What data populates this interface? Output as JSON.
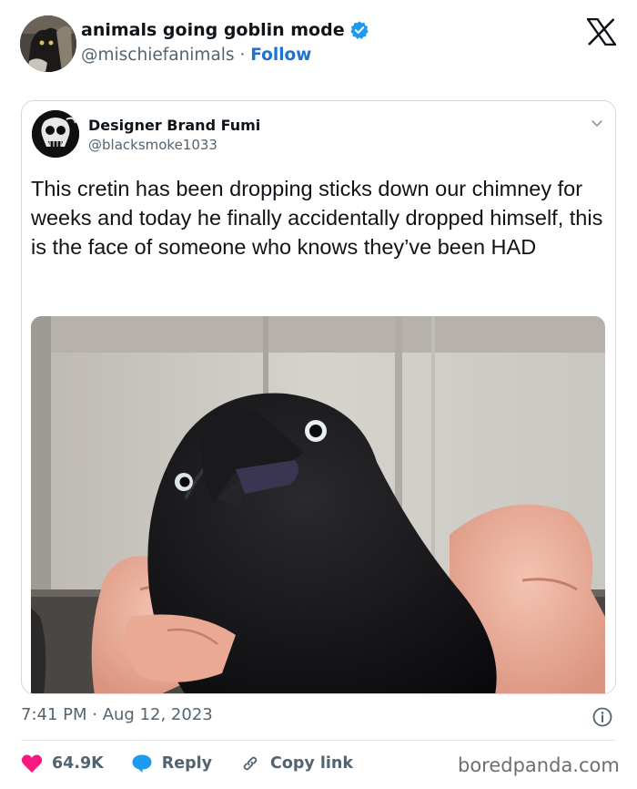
{
  "author": {
    "name": "animals going goblin mode",
    "handle": "@mischiefanimals",
    "separator": "·",
    "follow_label": "Follow",
    "verified": true
  },
  "quoted_tweet": {
    "name": "Designer Brand Fumi",
    "handle": "@blacksmoke1033",
    "text": "This cretin has been dropping sticks down our chimney for weeks and today he finally accidentally dropped himself, this is the face of someone who knows they’ve been HAD"
  },
  "timestamp": "7:41 PM · Aug 12, 2023",
  "actions": {
    "like_count": "64.9K",
    "reply_label": "Reply",
    "copy_label": "Copy link"
  },
  "watermark": "boredpanda.com",
  "icons": {
    "verified": "verified-badge-icon",
    "platform": "x-logo-icon",
    "chevron": "chevron-down-icon",
    "info": "info-icon",
    "like": "heart-icon",
    "reply": "reply-bubble-icon",
    "copy": "link-icon"
  },
  "colors": {
    "accent": "#1d9bf0",
    "follow": "#1d72d2",
    "like": "#f91880",
    "secondary_text": "#536471",
    "border": "#cfd9de"
  }
}
